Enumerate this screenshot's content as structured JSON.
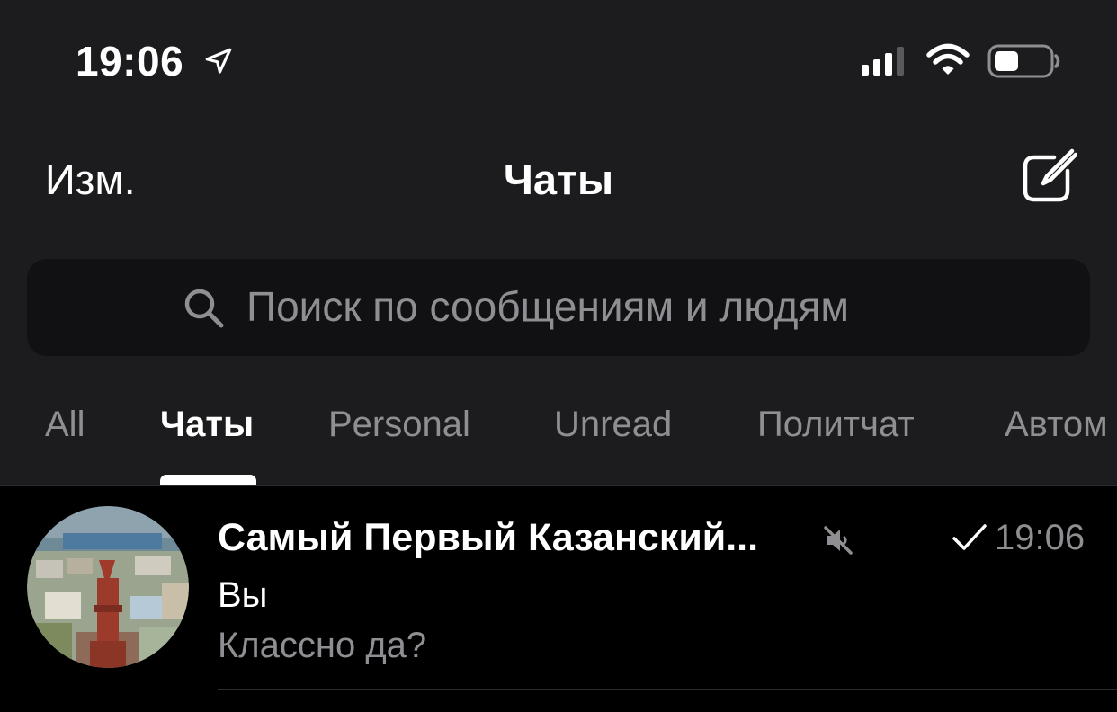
{
  "status_bar": {
    "time": "19:06",
    "location_icon": "location-arrow-icon",
    "signal_icon": "cellular-signal-icon",
    "wifi_icon": "wifi-icon",
    "battery_icon": "battery-icon"
  },
  "nav": {
    "edit_label": "Изм.",
    "title": "Чаты",
    "compose_icon": "compose-icon"
  },
  "search": {
    "placeholder": "Поиск по сообщениям и людям",
    "icon": "search-icon"
  },
  "tabs": [
    {
      "label": "All",
      "active": false
    },
    {
      "label": "Чаты",
      "active": true
    },
    {
      "label": "Personal",
      "active": false
    },
    {
      "label": "Unread",
      "active": false
    },
    {
      "label": "Политчат",
      "active": false
    },
    {
      "label": "Автом",
      "active": false
    }
  ],
  "chats": [
    {
      "title": "Самый Первый Казанский...",
      "muted": true,
      "read_check": true,
      "time": "19:06",
      "sender": "Вы",
      "message": "Классно да?"
    }
  ],
  "colors": {
    "background": "#1c1c1e",
    "list_background": "#000000",
    "search_background": "#111113",
    "primary_text": "#ffffff",
    "secondary_text": "#8e8e93"
  }
}
